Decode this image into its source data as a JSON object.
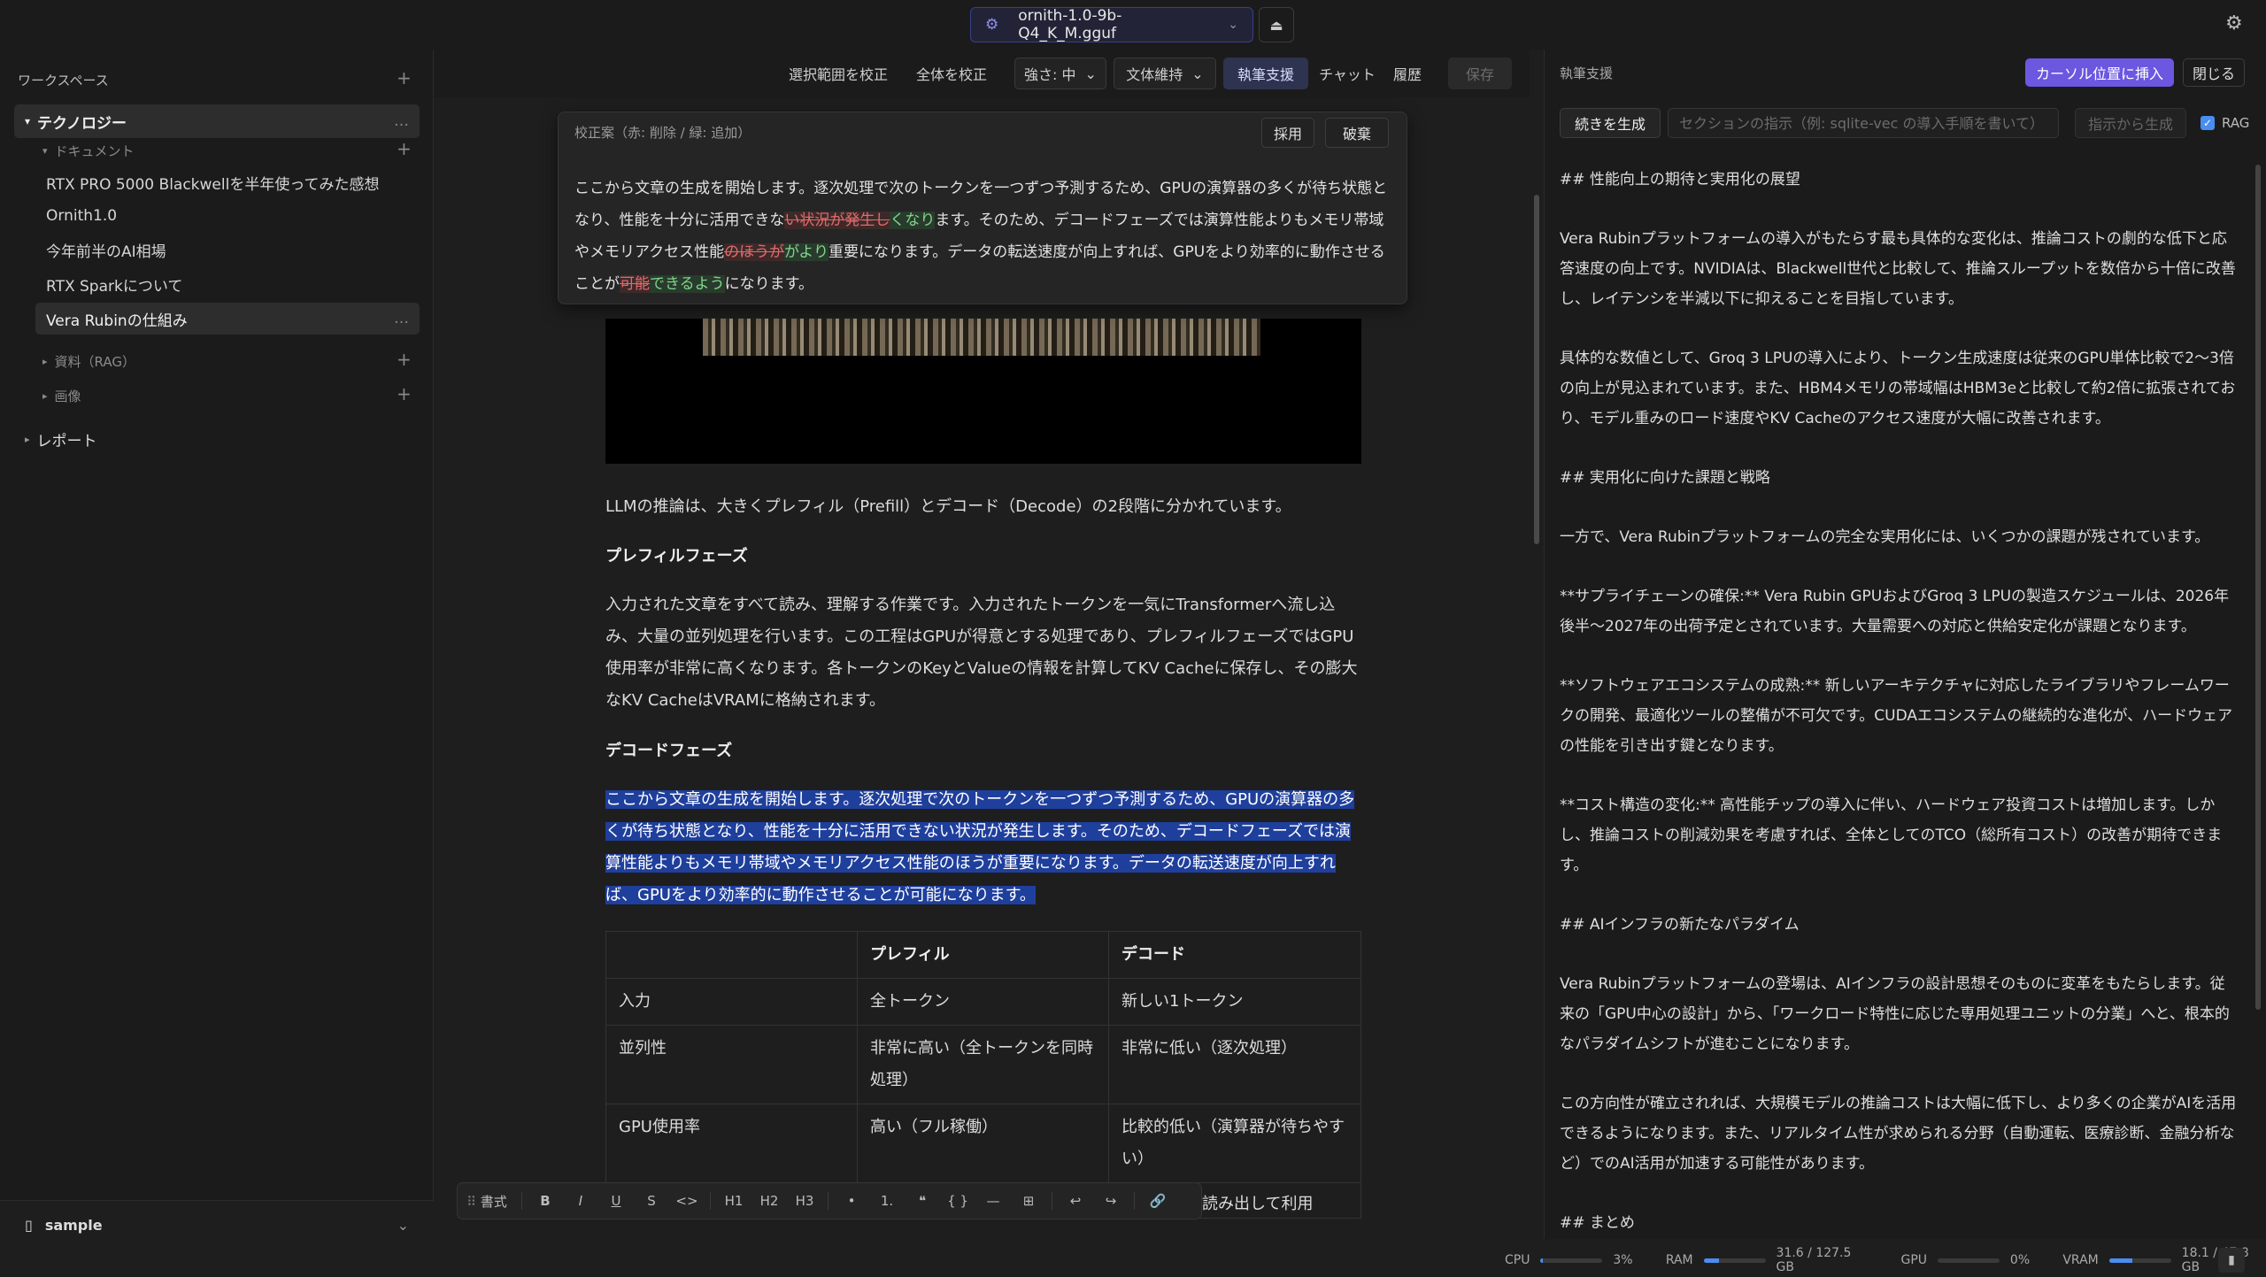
{
  "topbar": {
    "model": "ornith-1.0-9b-Q4_K_M.gguf"
  },
  "sidebar": {
    "workspace_label": "ワークスペース",
    "folder": "テクノロジー",
    "doc_group": "ドキュメント",
    "docs": [
      "RTX PRO 5000 Blackwellを半年使ってみた感想",
      "Ornith1.0",
      "今年前半のAI相場",
      "RTX Sparkについて",
      "Vera Rubinの仕組み"
    ],
    "rag_group": "資料（RAG）",
    "image_group": "画像",
    "report": "レポート",
    "footer": "sample"
  },
  "toolbar": {
    "fix_selection": "選択範囲を校正",
    "fix_all": "全体を校正",
    "strength": "強さ: 中",
    "style": "文体維持",
    "writing_assist": "執筆支援",
    "chat": "チャット",
    "history": "履歴",
    "save": "保存"
  },
  "proofread": {
    "header": "校正案（赤: 削除 / 緑: 追加）",
    "adopt": "採用",
    "discard": "破棄",
    "t1": "ここから文章の生成を開始します。逐次処理で次のトークンを一つずつ予測するため、GPUの演算器の多くが待ち状態となり、性能を十分に活用できな",
    "d1": "い状況が発生し",
    "a1": "くなり",
    "t2": "ます。そのため、デコードフェーズでは演算性能よりもメモリ帯域やメモリアクセス性能",
    "d2": "のほうが",
    "a2": "がより",
    "t3": "重要になります。データの転送速度が向上すれば、GPUをより効率的に動作させることが",
    "d3": "可能",
    "a3": "できるよう",
    "t4": "になります。"
  },
  "doc": {
    "intro": "LLMの推論は、大きくプレフィル（Prefill）とデコード（Decode）の2段階に分かれています。",
    "h_prefill": "プレフィルフェーズ",
    "p_prefill": "入力された文章をすべて読み、理解する作業です。入力されたトークンを一気にTransformerへ流し込み、大量の並列処理を行います。この工程はGPUが得意とする処理であり、プレフィルフェーズではGPU使用率が非常に高くなります。各トークンのKeyとValueの情報を計算してKV Cacheに保存し、その膨大なKV CacheはVRAMに格納されます。",
    "h_decode": "デコードフェーズ",
    "p_decode": "ここから文章の生成を開始します。逐次処理で次のトークンを一つずつ予測するため、GPUの演算器の多くが待ち状態となり、性能を十分に活用できない状況が発生します。そのため、デコードフェーズでは演算性能よりもメモリ帯域やメモリアクセス性能のほうが重要になります。データの転送速度が向上すれば、GPUをより効率的に動作させることが可能になります。",
    "table": {
      "headers": [
        "",
        "プレフィル",
        "デコード"
      ],
      "rows": [
        [
          "入力",
          "全トークン",
          "新しい1トークン"
        ],
        [
          "並列性",
          "非常に高い（全トークンを同時処理）",
          "非常に低い（逐次処理）"
        ],
        [
          "GPU使用率",
          "高い（フル稼働）",
          "比較的低い（演算器が待ちやすい）"
        ]
      ]
    },
    "tail": "読み出して利用"
  },
  "format_bar": {
    "style": "書式",
    "items": [
      "B",
      "I",
      "U",
      "S",
      "<>",
      "H1",
      "H2",
      "H3",
      "•",
      "1.",
      "❝",
      "{ }",
      "—",
      "⊞",
      "↩",
      "↪",
      "🔗"
    ]
  },
  "assist": {
    "title": "執筆支援",
    "insert": "カーソル位置に挿入",
    "close": "閉じる",
    "generate": "続きを生成",
    "placeholder": "セクションの指示（例: sqlite-vec の導入手順を書いて）",
    "from_instruction": "指示から生成",
    "rag": "RAG",
    "paragraphs": [
      "## 性能向上の期待と実用化の展望",
      "Vera Rubinプラットフォームの導入がもたらす最も具体的な変化は、推論コストの劇的な低下と応答速度の向上です。NVIDIAは、Blackwell世代と比較して、推論スループットを数倍から十倍に改善し、レイテンシを半減以下に抑えることを目指しています。",
      "具体的な数値として、Groq 3 LPUの導入により、トークン生成速度は従来のGPU単体比較で2〜3倍の向上が見込まれています。また、HBM4メモリの帯域幅はHBM3eと比較して約2倍に拡張されており、モデル重みのロード速度やKV Cacheのアクセス速度が大幅に改善されます。",
      "## 実用化に向けた課題と戦略",
      "一方で、Vera Rubinプラットフォームの完全な実用化には、いくつかの課題が残されています。",
      "**サプライチェーンの確保:** Vera Rubin GPUおよびGroq 3 LPUの製造スケジュールは、2026年後半〜2027年の出荷予定とされています。大量需要への対応と供給安定化が課題となります。",
      "**ソフトウェアエコシステムの成熟:** 新しいアーキテクチャに対応したライブラリやフレームワークの開発、最適化ツールの整備が不可欠です。CUDAエコシステムの継続的な進化が、ハードウェアの性能を引き出す鍵となります。",
      "**コスト構造の変化:** 高性能チップの導入に伴い、ハードウェア投資コストは増加します。しかし、推論コストの削減効果を考慮すれば、全体としてのTCO（総所有コスト）の改善が期待できます。",
      "## AIインフラの新たなパラダイム",
      "Vera Rubinプラットフォームの登場は、AIインフラの設計思想そのものに変革をもたらします。従来の「GPU中心の設計」から、「ワークロード特性に応じた専用処理ユニットの分業」へと、根本的なパラダイムシフトが進むことになります。",
      "この方向性が確立されれば、大規模モデルの推論コストは大幅に低下し、より多くの企業がAIを活用できるようになります。また、リアルタイム性が求められる分野（自動運転、医療診断、金融分析など）でのAI活用が加速する可能性があります。",
      "## まとめ"
    ]
  },
  "status": {
    "cpu_label": "CPU",
    "cpu_value": "3%",
    "cpu_fraction": 0.03,
    "ram_label": "RAM",
    "ram_value": "31.6 / 127.5 GB",
    "ram_fraction": 0.248,
    "gpu_label": "GPU",
    "gpu_value": "0%",
    "gpu_fraction": 0.0,
    "vram_label": "VRAM",
    "vram_value": "18.1 / 47.8 GB",
    "vram_fraction": 0.379
  },
  "colors": {
    "accent": "#6b57e0",
    "selection": "#1f3f9c",
    "meter": "#4a8df0"
  }
}
